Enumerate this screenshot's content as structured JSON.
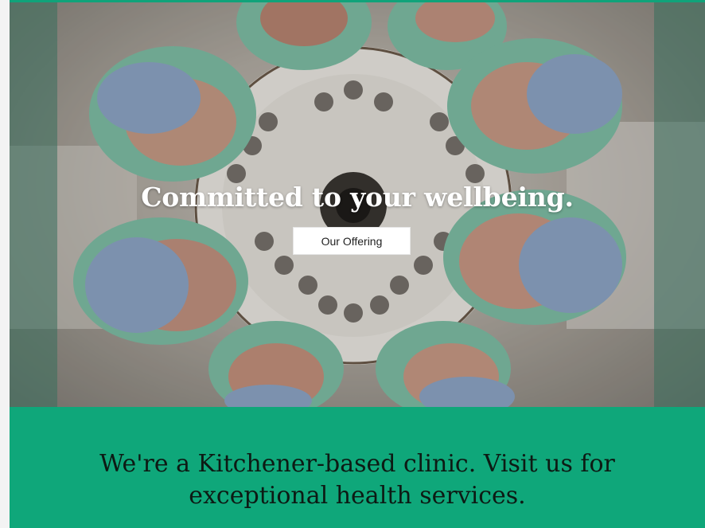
{
  "hero": {
    "title": "Committed to your wellbeing.",
    "button_label": "Our Offering"
  },
  "intro": {
    "line1": "We're a Kitchener-based clinic. Visit us for",
    "line2": "exceptional health services."
  },
  "colors": {
    "brand_green": "#0fa77a",
    "cap_green": "#7fbfa6",
    "mask_blue": "#8ea6c6"
  }
}
